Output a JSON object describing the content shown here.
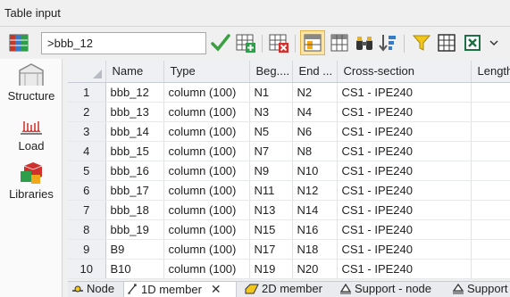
{
  "window": {
    "title": "Table input"
  },
  "toolbar": {
    "name_field_value": ">bbb_12",
    "icons": [
      "table-grid-icon",
      "confirm-check-icon",
      "table-add-icon",
      "table-delete-icon",
      "filter-column-icon",
      "table-view-icon",
      "binoculars-icon",
      "sort-icon",
      "filter-icon",
      "grid-settings-icon",
      "excel-icon"
    ]
  },
  "sidebar": {
    "items": [
      {
        "label": "Structure",
        "icon": "structure-icon"
      },
      {
        "label": "Load",
        "icon": "load-icon"
      },
      {
        "label": "Libraries",
        "icon": "libraries-icon"
      }
    ]
  },
  "table": {
    "columns": [
      "Name",
      "Type",
      "Beg....",
      "End ...",
      "Cross-section",
      "Length"
    ],
    "rows": [
      {
        "num": "1",
        "name": "bbb_12",
        "type": "column (100)",
        "beg": "N1",
        "end": "N2",
        "cs": "CS1 - IPE240"
      },
      {
        "num": "2",
        "name": "bbb_13",
        "type": "column (100)",
        "beg": "N3",
        "end": "N4",
        "cs": "CS1 - IPE240"
      },
      {
        "num": "3",
        "name": "bbb_14",
        "type": "column (100)",
        "beg": "N5",
        "end": "N6",
        "cs": "CS1 - IPE240"
      },
      {
        "num": "4",
        "name": "bbb_15",
        "type": "column (100)",
        "beg": "N7",
        "end": "N8",
        "cs": "CS1 - IPE240"
      },
      {
        "num": "5",
        "name": "bbb_16",
        "type": "column (100)",
        "beg": "N9",
        "end": "N10",
        "cs": "CS1 - IPE240"
      },
      {
        "num": "6",
        "name": "bbb_17",
        "type": "column (100)",
        "beg": "N11",
        "end": "N12",
        "cs": "CS1 - IPE240"
      },
      {
        "num": "7",
        "name": "bbb_18",
        "type": "column (100)",
        "beg": "N13",
        "end": "N14",
        "cs": "CS1 - IPE240"
      },
      {
        "num": "8",
        "name": "bbb_19",
        "type": "column (100)",
        "beg": "N15",
        "end": "N16",
        "cs": "CS1 - IPE240"
      },
      {
        "num": "9",
        "name": "B9",
        "type": "column (100)",
        "beg": "N17",
        "end": "N18",
        "cs": "CS1 - IPE240"
      },
      {
        "num": "10",
        "name": "B10",
        "type": "column (100)",
        "beg": "N19",
        "end": "N20",
        "cs": "CS1 - IPE240"
      }
    ]
  },
  "tabs": [
    {
      "label": "Node",
      "icon": "node-icon"
    },
    {
      "label": "1D member",
      "icon": "member-1d-icon",
      "active": true,
      "close": "✕"
    },
    {
      "label": "2D member",
      "icon": "member-2d-icon"
    },
    {
      "label": "Support - node",
      "icon": "support-node-icon"
    },
    {
      "label": "Support",
      "icon": "support-icon"
    }
  ],
  "colors": {
    "accent_green": "#3aa040",
    "active_tool_bg": "#fbe4a6",
    "header_bg": "#eef0f3"
  }
}
